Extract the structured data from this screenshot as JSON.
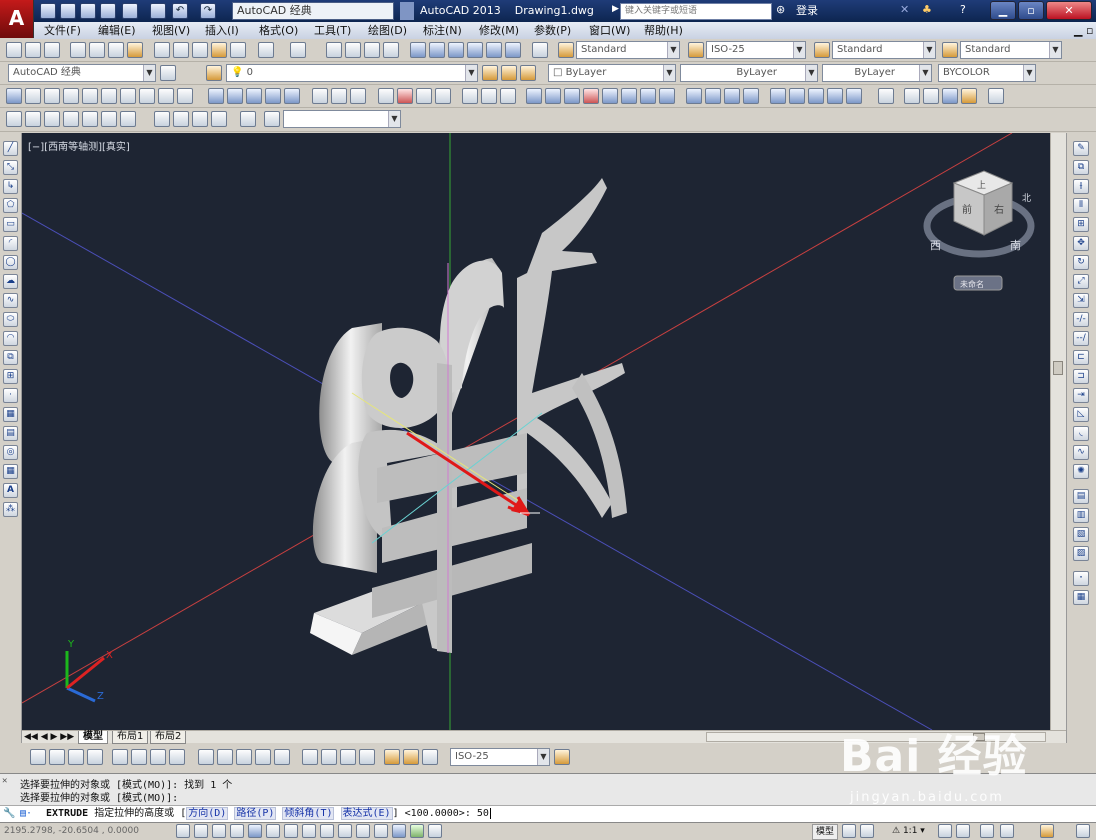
{
  "title_bar": {
    "workspace": "AutoCAD 经典",
    "app_name": "AutoCAD 2013",
    "document": "Drawing1.dwg",
    "search_placeholder": "键入关键字或短语",
    "login": "登录"
  },
  "menu": [
    "文件(F)",
    "编辑(E)",
    "视图(V)",
    "插入(I)",
    "格式(O)",
    "工具(T)",
    "绘图(D)",
    "标注(N)",
    "修改(M)",
    "参数(P)",
    "窗口(W)",
    "帮助(H)"
  ],
  "styles_toolbar": {
    "text_style": "Standard",
    "dim_style": "ISO-25",
    "table_style": "Standard",
    "multileader_style": "Standard"
  },
  "layers_toolbar": {
    "workspace": "AutoCAD 经典",
    "layer": "0",
    "color": "ByLayer",
    "linetype": "ByLayer",
    "lineweight": "ByLayer",
    "plot_style": "BYCOLOR"
  },
  "viewport": {
    "label": "[−][西南等轴测][真实]",
    "viewcube": {
      "top": "上",
      "front": "前",
      "right": "右",
      "south": "南",
      "west": "西",
      "north": "北",
      "ucs": "未命名"
    },
    "ucs_axes": {
      "x": "X",
      "y": "Y",
      "z": "Z"
    }
  },
  "layout_tabs": [
    "模型",
    "布局1",
    "布局2"
  ],
  "bottom_toolbar": {
    "dim_style": "ISO-25"
  },
  "command_history": [
    "选择要拉伸的对象或 [模式(MO)]: 找到 1 个",
    "选择要拉伸的对象或 [模式(MO)]:"
  ],
  "command_line": {
    "command": "EXTRUDE",
    "prompt": "指定拉伸的高度或",
    "options": [
      "方向(D)",
      "路径(P)",
      "倾斜角(T)",
      "表达式(E)"
    ],
    "default": "<100.0000>:",
    "input": "50"
  },
  "status_bar": {
    "coords": "2195.2798, -20.6504 , 0.0000",
    "model": "模型",
    "scale": "1:1"
  },
  "watermark": {
    "brand": "Bai 经验",
    "url": "jingyan.baidu.com"
  },
  "colors": {
    "viewport_bg": "#1e2533",
    "title_bg": "#1f3c78",
    "arrow": "#e01818"
  }
}
